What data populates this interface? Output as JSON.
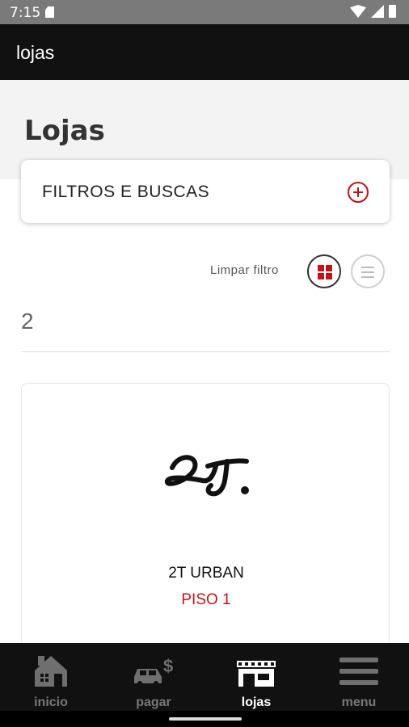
{
  "status_bar": {
    "time": "7:15",
    "icons": [
      "sd-card-icon",
      "wifi-icon",
      "cell-signal-icon",
      "battery-icon"
    ]
  },
  "app_bar": {
    "title": "lojas"
  },
  "page": {
    "title": "Lojas"
  },
  "filters": {
    "label": "FILTROS E BUSCAS",
    "icon": "plus-circle-icon",
    "accent": "#b8141b"
  },
  "toolbar": {
    "clear_label": "Limpar filtro",
    "active_view": "grid"
  },
  "results": {
    "count": "2"
  },
  "stores": [
    {
      "logo_text": "2T.",
      "name": "2T URBAN",
      "floor": "PISO 1"
    }
  ],
  "bottom_nav": {
    "items": [
      {
        "label": "inicio",
        "icon": "house-icon"
      },
      {
        "label": "pagar",
        "icon": "car-dollar-icon"
      },
      {
        "label": "lojas",
        "icon": "storefront-icon",
        "active": true
      },
      {
        "label": "menu",
        "icon": "hamburger-menu-icon"
      }
    ]
  },
  "colors": {
    "brand_red": "#c0141b",
    "app_bar_bg": "#111111"
  }
}
